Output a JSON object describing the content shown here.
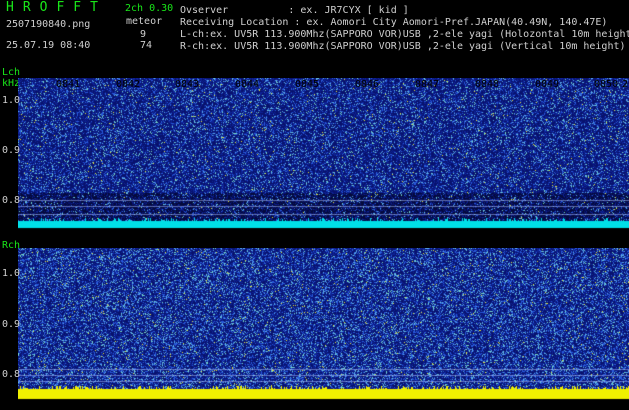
{
  "header": {
    "app_title": "HROFFT",
    "mode": "2ch 0.30",
    "filename": "2507190840.png",
    "meteor_label": "meteor",
    "datetime": "25.07.19 08:40",
    "lch_count": "9",
    "rch_count": "74"
  },
  "info": {
    "observer": "Ovserver          : ex. JR7CYX [ kid ]",
    "location": "Receiving Location : ex. Aomori City Aomori-Pref.JAPAN(40.49N, 140.47E)",
    "lch": "L-ch:ex. UV5R 113.900Mhz(SAPPORO VOR)USB ,2-ele yagi (Holozontal 10m height)",
    "rch": "R-ch:ex. UV5R 113.900Mhz(SAPPORO VOR)USB ,2-ele yagi (Vertical 10m height)"
  },
  "spectrogram": {
    "lch_label": "Lch",
    "rch_label": "Rch",
    "unit": "kHz",
    "freq_ticks": [
      "1.0",
      "0.9",
      "0.8"
    ],
    "time_ticks": [
      "0841",
      "0842",
      "0843",
      "0844",
      "0845",
      "0846",
      "0847",
      "0848",
      "0849",
      "0850"
    ],
    "edge_tick": "2"
  },
  "colors": {
    "background": "#000000",
    "text_green": "#19e619",
    "text_gray": "#cfcfcf",
    "noise_blue": "#10208a",
    "carrier_cyan": "#00e0e8",
    "carrier_yellow": "#f0f000"
  }
}
